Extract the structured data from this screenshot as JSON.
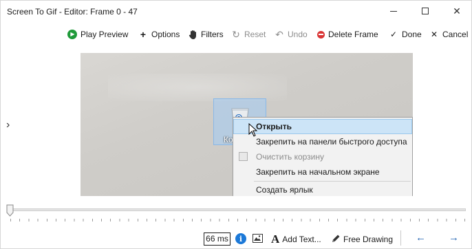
{
  "window": {
    "title": "Screen To Gif - Editor: Frame 0 - 47"
  },
  "toolbar": {
    "play_preview": "Play Preview",
    "options": "Options",
    "filters": "Filters",
    "reset": "Reset",
    "undo": "Undo",
    "delete_frame": "Delete Frame",
    "done": "Done",
    "cancel": "Cancel"
  },
  "frame": {
    "icon_label": "Ко",
    "context_menu": {
      "items": [
        "Открыть",
        "Закрепить на панели быстрого доступа",
        "Очистить корзину",
        "Закрепить на начальном экране",
        "Создать ярлык"
      ]
    }
  },
  "statusbar": {
    "delay": "66 ms",
    "add_text": "Add Text...",
    "free_drawing": "Free Drawing"
  },
  "colors": {
    "play_green": "#1f9a3a",
    "delete_red": "#d93434",
    "info_blue": "#1c79d8",
    "menu_highlight": "#cce4f7"
  }
}
